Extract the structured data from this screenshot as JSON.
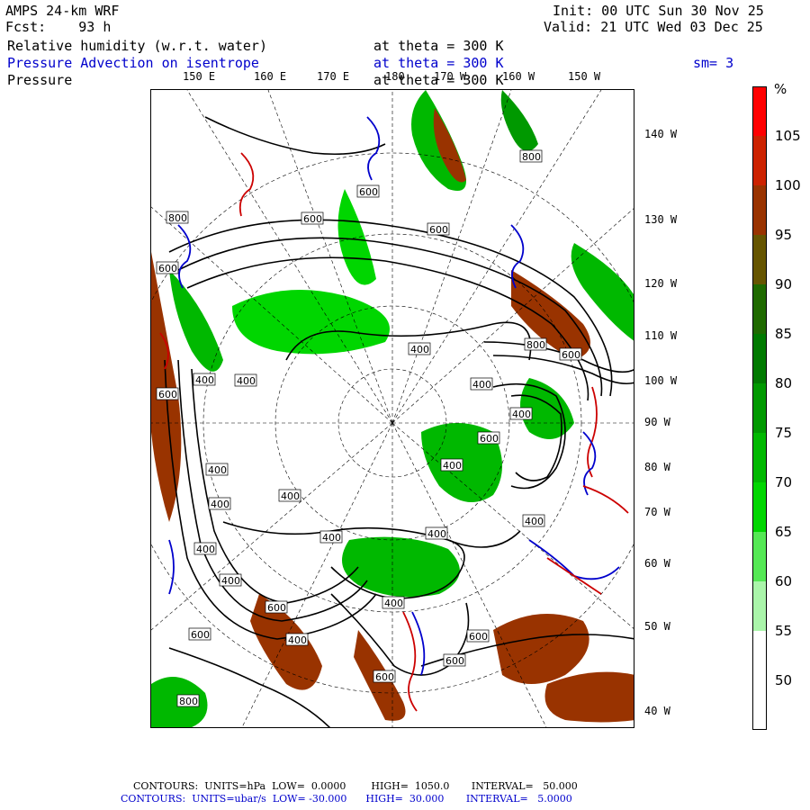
{
  "header": {
    "model": "AMPS 24-km WRF",
    "forecast": "Fcst:    93 h",
    "init": "Init: 00 UTC Sun 30 Nov 25",
    "valid": "Valid: 21 UTC Wed 03 Dec 25",
    "field1_name": "Relative humidity (w.r.t. water)",
    "field1_level": "at theta = 300 K",
    "field2_name": "Pressure Advection on isentrope",
    "field2_level": "at theta = 300 K",
    "field2_smooth": "sm= 3",
    "field3_name": "Pressure",
    "field3_level": "at theta = 300 K"
  },
  "top_lon_labels": [
    "150 E",
    "160 E",
    "170 E",
    "180",
    "170 W",
    "160 W",
    "150 W"
  ],
  "right_lon_labels": [
    "140 W",
    "130 W",
    "120 W",
    "110 W",
    "100 W",
    "90 W",
    "80 W",
    "70 W",
    "60 W",
    "50 W",
    "40 W"
  ],
  "contour_labels": [
    "800",
    "600",
    "600",
    "600",
    "800",
    "600",
    "800",
    "400",
    "400",
    "600",
    "600",
    "400",
    "400",
    "400",
    "400",
    "400",
    "400",
    "400",
    "400",
    "400",
    "400",
    "400",
    "400",
    "400",
    "600",
    "600",
    "400",
    "600",
    "600",
    "600",
    "800",
    "600"
  ],
  "colorbar": {
    "unit": "%",
    "ticks": [
      "105",
      "100",
      "95",
      "90",
      "85",
      "80",
      "75",
      "70",
      "65",
      "60",
      "55",
      "50"
    ],
    "colors": [
      "#ff0000",
      "#cc2200",
      "#993300",
      "#665500",
      "#1f6a00",
      "#007a00",
      "#009900",
      "#00b800",
      "#00d600",
      "#55e855",
      "#aaf5aa",
      "#ffffff",
      "#ffffff"
    ]
  },
  "footer": {
    "line1": "CONTOURS:  UNITS=hPa  LOW=  0.0000        HIGH=  1050.0       INTERVAL=   50.000",
    "line2": "CONTOURS:  UNITS=ubar/s  LOW= -30.000      HIGH=  30.000       INTERVAL=   5.0000"
  }
}
